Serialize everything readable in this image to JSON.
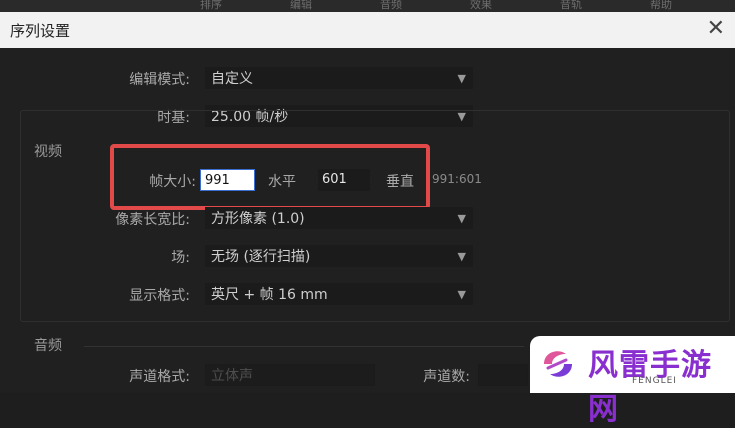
{
  "top_menu": [
    "排序",
    "编辑",
    "音频",
    "效果",
    "音轨",
    "帮助"
  ],
  "dialog": {
    "title": "序列设置",
    "close_glyph": "✕"
  },
  "fields": {
    "editing_mode": {
      "label": "编辑模式:",
      "value": "自定义"
    },
    "timebase": {
      "label": "时基:",
      "value": "25.00 帧/秒"
    }
  },
  "video": {
    "section_label": "视频",
    "frame_size_label": "帧大小:",
    "width_value": "991",
    "horizontal_label": "水平",
    "height_value": "601",
    "vertical_label": "垂直",
    "ratio": "991:601",
    "pixel_aspect": {
      "label": "像素长宽比:",
      "value": "方形像素 (1.0)"
    },
    "field": {
      "label": "场:",
      "value": "无场 (逐行扫描)"
    },
    "display_format": {
      "label": "显示格式:",
      "value": "英尺 + 帧 16 mm"
    }
  },
  "audio": {
    "section_label": "音频",
    "channel_format": {
      "label": "声道格式:",
      "value": "立体声"
    },
    "channel_count_label": "声道数:"
  },
  "watermark": {
    "title": "风雷手游网",
    "subtitle": "FENGLEI"
  },
  "colors": {
    "highlight": "#e24a4a",
    "brand": "#8a2fcf"
  }
}
